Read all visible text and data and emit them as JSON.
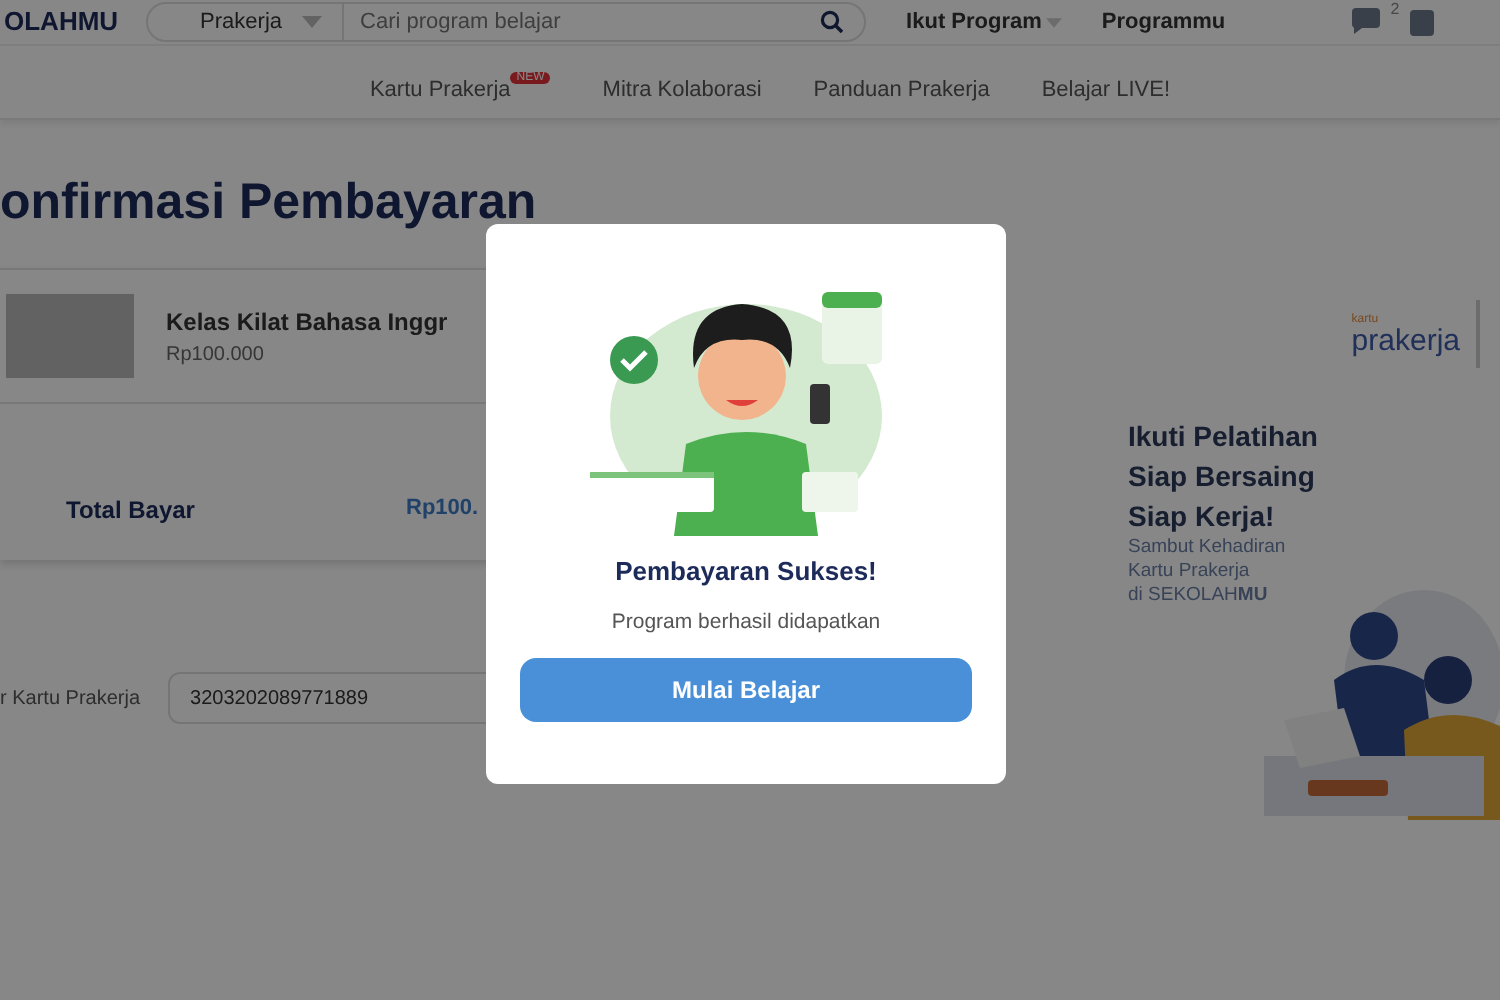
{
  "header": {
    "logo": "OLAHMU",
    "category": "Prakerja",
    "search": {
      "placeholder": "Cari program belajar"
    },
    "links": [
      {
        "label": "Ikut Program",
        "kind": "dropdown"
      },
      {
        "label": "Programmu",
        "kind": "plain"
      }
    ],
    "chat_badge": "2"
  },
  "nav": {
    "items": [
      {
        "label": "Kartu Prakerja",
        "badge": "NEW"
      },
      {
        "label": "Mitra Kolaborasi"
      },
      {
        "label": "Panduan Prakerja"
      },
      {
        "label": "Belajar LIVE!"
      }
    ]
  },
  "page": {
    "title": "onfirmasi Pembayaran",
    "course": {
      "name": "Kelas Kilat Bahasa Inggr",
      "price": "Rp100.000"
    },
    "total": {
      "label": "Total Bayar",
      "value": "Rp100."
    },
    "card_field": {
      "label": "r Kartu Prakerja",
      "value": "3203202089771889"
    }
  },
  "banner": {
    "logo_small": "kartu",
    "logo": "prakerja",
    "headline": [
      "Ikuti Pelatihan",
      "Siap Bersaing",
      "Siap Kerja!"
    ],
    "sub": [
      "Sambut Kehadiran",
      "Kartu Prakerja",
      "di SEKOLAH**MU**"
    ]
  },
  "modal": {
    "title": "Pembayaran Sukses!",
    "message": "Program berhasil didapatkan",
    "button": "Mulai Belajar"
  }
}
